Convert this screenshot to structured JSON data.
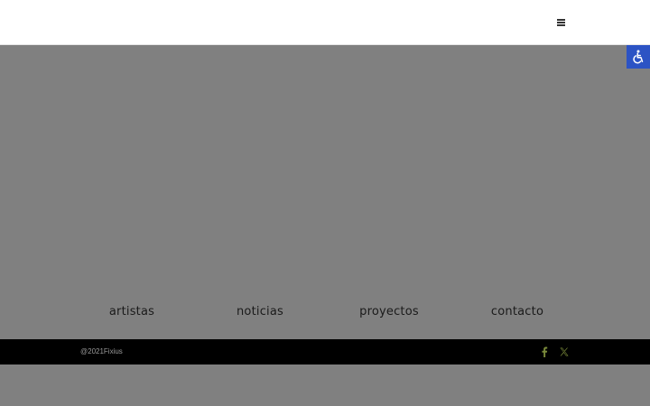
{
  "header": {
    "menu_icon": "hamburger-menu-icon"
  },
  "accessibility": {
    "icon": "wheelchair-icon",
    "color": "#2c53c4"
  },
  "nav": {
    "items": [
      {
        "label": "artistas"
      },
      {
        "label": "noticias"
      },
      {
        "label": "proyectos"
      },
      {
        "label": "contacto"
      }
    ]
  },
  "footer": {
    "copyright": "@2021Fixius",
    "social": [
      {
        "icon": "facebook-icon"
      },
      {
        "icon": "x-twitter-icon"
      }
    ],
    "social_color": "#7a8a3a"
  },
  "colors": {
    "background": "#808080",
    "header": "#ffffff",
    "footer": "#000000"
  }
}
